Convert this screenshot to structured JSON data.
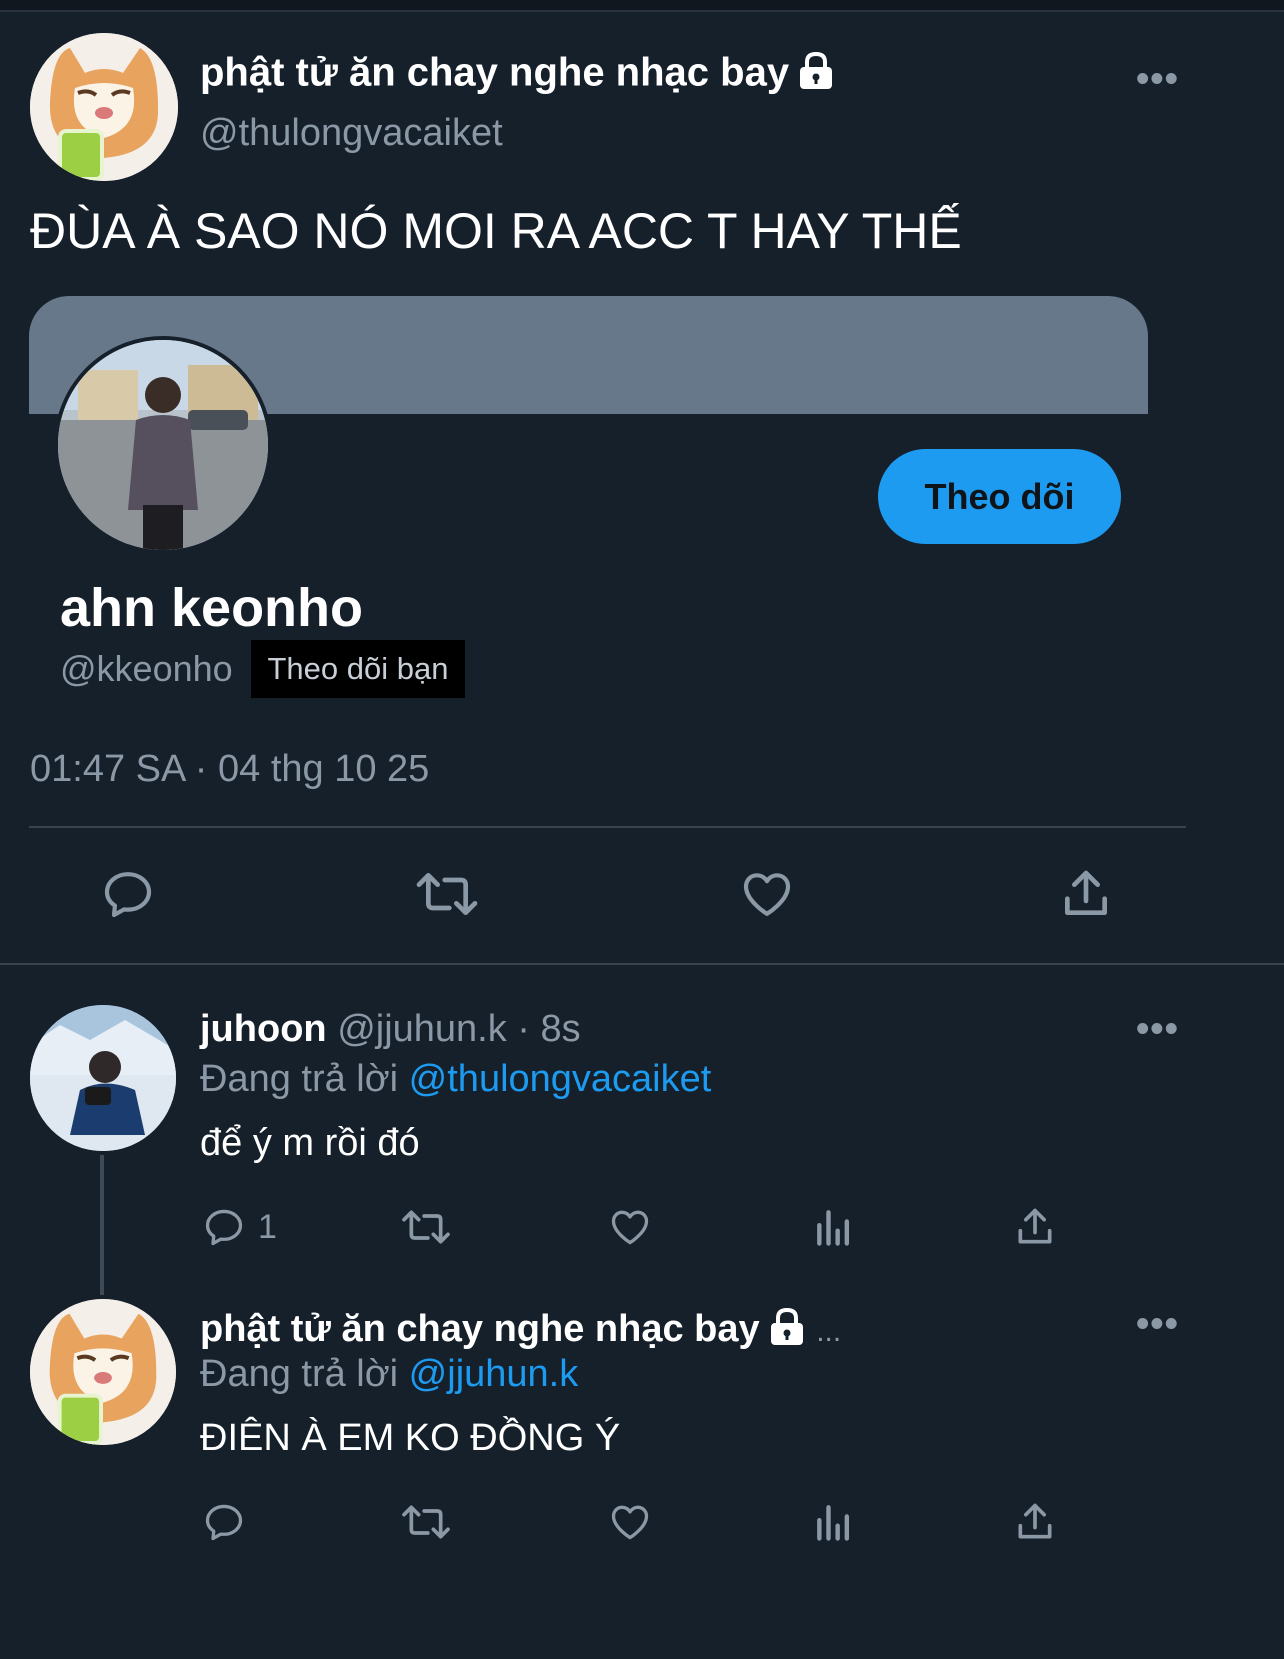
{
  "main_tweet": {
    "author_name": "phật tử ăn chay nghe nhạc bay",
    "author_handle": "@thulongvacaiket",
    "text": "ĐÙA À SAO NÓ MOI RA ACC T HAY THẾ",
    "timestamp": "01:47 SA · 04 thg 10 25"
  },
  "profile_card": {
    "name": "ahn keonho",
    "handle": "@kkeonho",
    "follows_you_badge": "Theo dõi bạn",
    "follow_button": "Theo dõi"
  },
  "replies": [
    {
      "author_name": "juhoon",
      "meta": "@jjuhun.k · 8s",
      "replying_prefix": "Đang trả lời",
      "replying_to": "@thulongvacaiket",
      "text": "để ý m rồi đó",
      "reply_count": "1"
    },
    {
      "author_name": "phật tử ăn chay nghe nhạc bay",
      "meta": "...",
      "replying_prefix": "Đang trả lời",
      "replying_to": "@jjuhun.k",
      "text": "ĐIÊN À EM KO ĐỒNG Ý",
      "reply_count": ""
    }
  ],
  "icons": {
    "more": "more-icon",
    "lock": "lock-icon",
    "reply": "reply-icon",
    "retweet": "retweet-icon",
    "like": "heart-icon",
    "views": "views-icon",
    "share": "share-icon"
  },
  "colors": {
    "background": "#15202b",
    "accent": "#1d9bf0",
    "secondary_text": "#8b98a5",
    "banner": "#66788a"
  }
}
